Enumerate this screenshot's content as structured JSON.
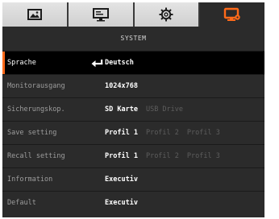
{
  "tabs": [
    {
      "icon": "image-icon",
      "active": false
    },
    {
      "icon": "display-settings-icon",
      "active": false
    },
    {
      "icon": "gear-icon",
      "active": false
    },
    {
      "icon": "monitor-icon",
      "active": true
    }
  ],
  "colors": {
    "accent": "#ff6a1a",
    "background": "#2b2b2b",
    "selected_row": "#000000"
  },
  "section_title": "SYSTEM",
  "rows": [
    {
      "label": "Sprache",
      "selected": true,
      "icon": "enter-icon",
      "options": [
        "Deutsch"
      ],
      "active_option": 0
    },
    {
      "label": "Monitorausgang",
      "selected": false,
      "options": [
        "1024x768"
      ],
      "active_option": 0
    },
    {
      "label": "Sicherungskop.",
      "selected": false,
      "options": [
        "SD Karte",
        "USB Drive"
      ],
      "active_option": 0
    },
    {
      "label": "Save setting",
      "selected": false,
      "options": [
        "Profil 1",
        "Profil 2",
        "Profil 3"
      ],
      "active_option": 0
    },
    {
      "label": "Recall setting",
      "selected": false,
      "options": [
        "Profil 1",
        "Profil 2",
        "Profil 3"
      ],
      "active_option": 0
    },
    {
      "label": "Information",
      "selected": false,
      "options": [
        "Executiv"
      ],
      "active_option": 0
    },
    {
      "label": "Default",
      "selected": false,
      "options": [
        "Executiv"
      ],
      "active_option": 0
    }
  ]
}
